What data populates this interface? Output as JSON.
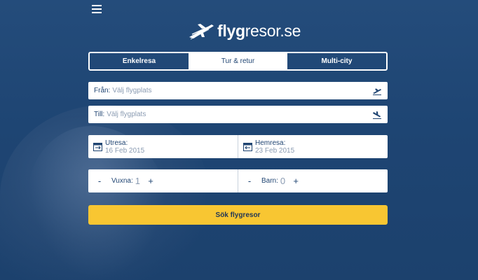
{
  "logo": {
    "brand_bold": "flyg",
    "brand_rest": "resor.se"
  },
  "tabs": [
    {
      "label": "Enkelresa",
      "active": false
    },
    {
      "label": "Tur & retur",
      "active": true
    },
    {
      "label": "Multi-city",
      "active": false
    }
  ],
  "from": {
    "label": "Från:",
    "placeholder": "Välj flygplats",
    "icon": "plane-takeoff-icon"
  },
  "to": {
    "label": "Till:",
    "placeholder": "Välj flygplats",
    "icon": "plane-landing-icon"
  },
  "dates": {
    "outbound": {
      "label": "Utresa:",
      "value": "16 Feb 2015",
      "icon": "calendar-icon"
    },
    "return": {
      "label": "Hemresa:",
      "value": "23 Feb 2015",
      "icon": "calendar-return-icon"
    }
  },
  "passengers": {
    "adults": {
      "label": "Vuxna:",
      "value": "1",
      "minus": "-",
      "plus": "+"
    },
    "children": {
      "label": "Barn:",
      "value": "0",
      "minus": "-",
      "plus": "+"
    }
  },
  "search_button": {
    "label": "Sök flygresor"
  },
  "colors": {
    "navy": "#1f4472",
    "yellow": "#f8c632",
    "white": "#ffffff",
    "placeholder": "#8a9bb2"
  }
}
